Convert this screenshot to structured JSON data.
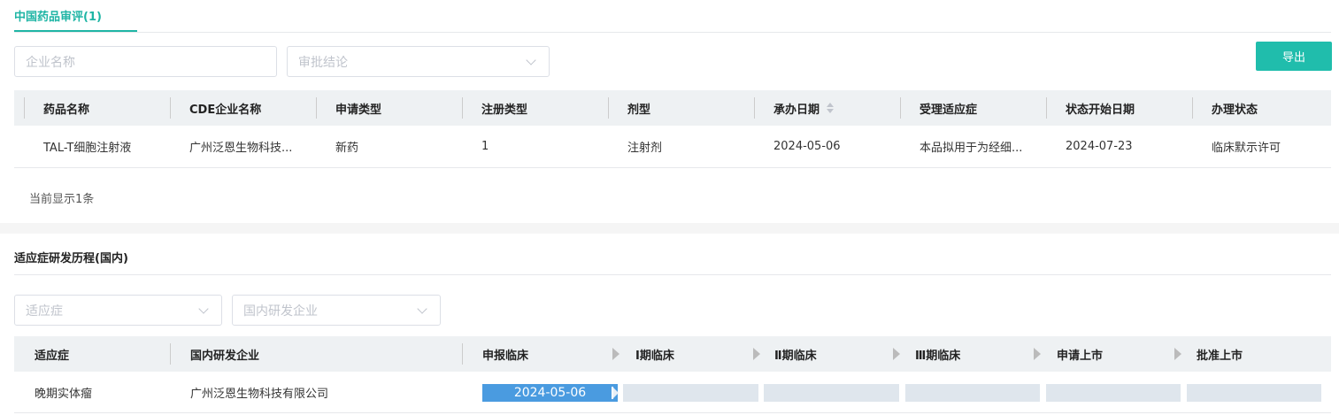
{
  "review": {
    "tab_label": "中国药品审评(1)",
    "company_placeholder": "企业名称",
    "conclusion_placeholder": "审批结论",
    "export_label": "导出",
    "columns": [
      "药品名称",
      "CDE企业名称",
      "申请类型",
      "注册类型",
      "剂型",
      "承办日期",
      "受理适应症",
      "状态开始日期",
      "办理状态"
    ],
    "rows": [
      [
        "TAL-T细胞注射液",
        "广州泛恩生物科技...",
        "新药",
        "1",
        "注射剂",
        "2024-05-06",
        "本品拟用于为经细...",
        "2024-07-23",
        "临床默示许可"
      ]
    ],
    "footer": "当前显示1条"
  },
  "history": {
    "title": "适应症研发历程(国内)",
    "indication_placeholder": "适应症",
    "company_placeholder": "国内研发企业",
    "columns": [
      "适应症",
      "国内研发企业"
    ],
    "stages": [
      "申报临床",
      "Ⅰ期临床",
      "Ⅱ期临床",
      "Ⅲ期临床",
      "申请上市",
      "批准上市"
    ],
    "rows": [
      {
        "indication": "晚期实体瘤",
        "company": "广州泛恩生物科技有限公司",
        "stage_dates": [
          "2024-05-06",
          "",
          "",
          "",
          "",
          ""
        ]
      }
    ]
  },
  "colors": {
    "accent": "#20bdac",
    "stage_active": "#4a9be0"
  }
}
